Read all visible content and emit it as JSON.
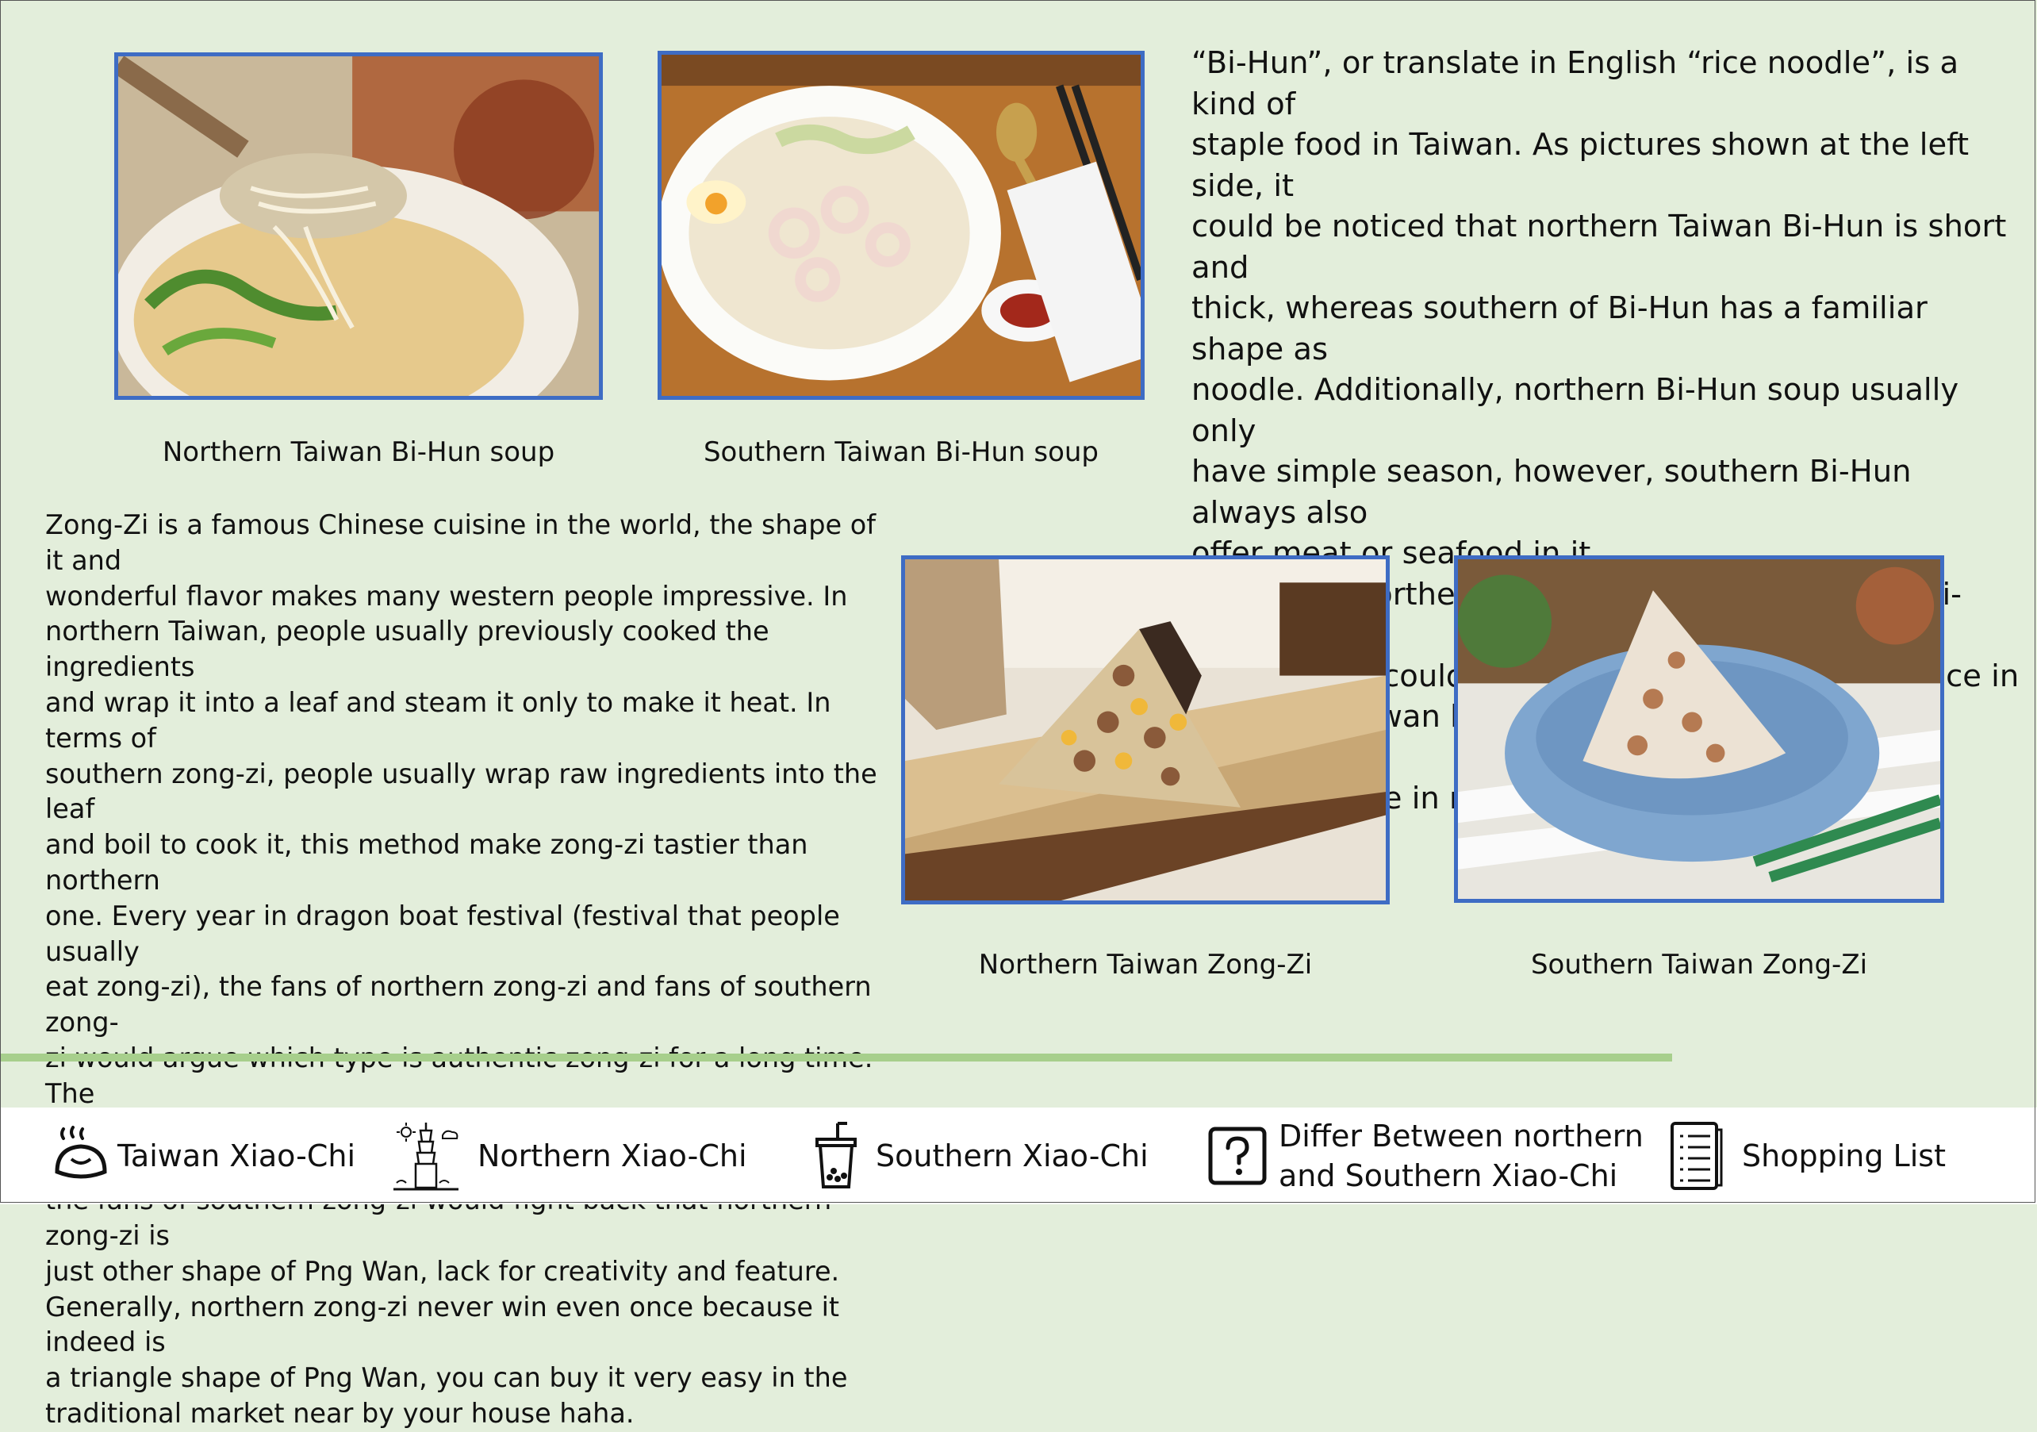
{
  "bihun": {
    "paragraph": "“Bi-Hun”, or translate in English “rice noodle”, is a kind of\nstaple food in Taiwan. As pictures shown at the left side, it\ncould be noticed that northern Taiwan Bi-Hun is short and\nthick, whereas southern of Bi-Hun has a familiar shape as\nnoodle. Additionally, northern Bi-Hun soup usually only\nhave simple season, however, southern Bi-Hun always also\noffer meat or seafood in it.\nMoreover, northern Bi-Hun has its other name ”Bi-Thai-\nBak”, which could only be added into traditional ice in\nsouthern Taiwan but could be made as soup and added into\ntraditional ice in northern Taiwan.",
    "northern_caption": "Northern Taiwan Bi-Hun soup",
    "southern_caption": "Southern Taiwan Bi-Hun soup"
  },
  "zongzi": {
    "paragraph": "Zong-Zi is a famous Chinese cuisine in the world, the shape of it and\nwonderful flavor makes many western people impressive. In\nnorthern Taiwan, people usually previously cooked the ingredients\nand wrap it into a leaf and steam it only to make it heat. In terms of\nsouthern zong-zi, people usually wrap raw ingredients into the leaf\nand boil to cook it, this method make zong-zi tastier than  northern\none. Every year in dragon boat festival (festival that people usually\neat zong-zi), the fans of northern zong-zi and fans of southern zong-\nzi would argue which type is authentic zong-zi for a long time. The\nfan of northern zong-zi would argue southern zong-zi is mushy and\nthe fans of southern zong-zi would fight back that northern zong-zi is\njust other shape of Png Wan, lack for creativity and feature.\nGenerally, northern zong-zi never win even once because it indeed is\na triangle shape of Png Wan, you can buy it very easy in the\ntraditional market near by your house haha.",
    "northern_caption": "Northern Taiwan Zong-Zi",
    "southern_caption": "Southern Taiwan Zong-Zi"
  },
  "nav": {
    "items": [
      {
        "label": "Taiwan Xiao-Chi",
        "icon": "steamed-bun-icon"
      },
      {
        "label": "Northern Xiao-Chi",
        "icon": "taipei-101-icon"
      },
      {
        "label": "Southern Xiao-Chi",
        "icon": "bubble-tea-icon"
      },
      {
        "label": "Differ Between northern\nand Southern Xiao-Chi",
        "icon": "question-box-icon"
      },
      {
        "label": "Shopping List",
        "icon": "checklist-icon"
      }
    ]
  },
  "colors": {
    "background": "#e3eedb",
    "photo_border": "#3e6cc4",
    "divider": "#a7cf8c",
    "navbar": "#ffffff"
  }
}
